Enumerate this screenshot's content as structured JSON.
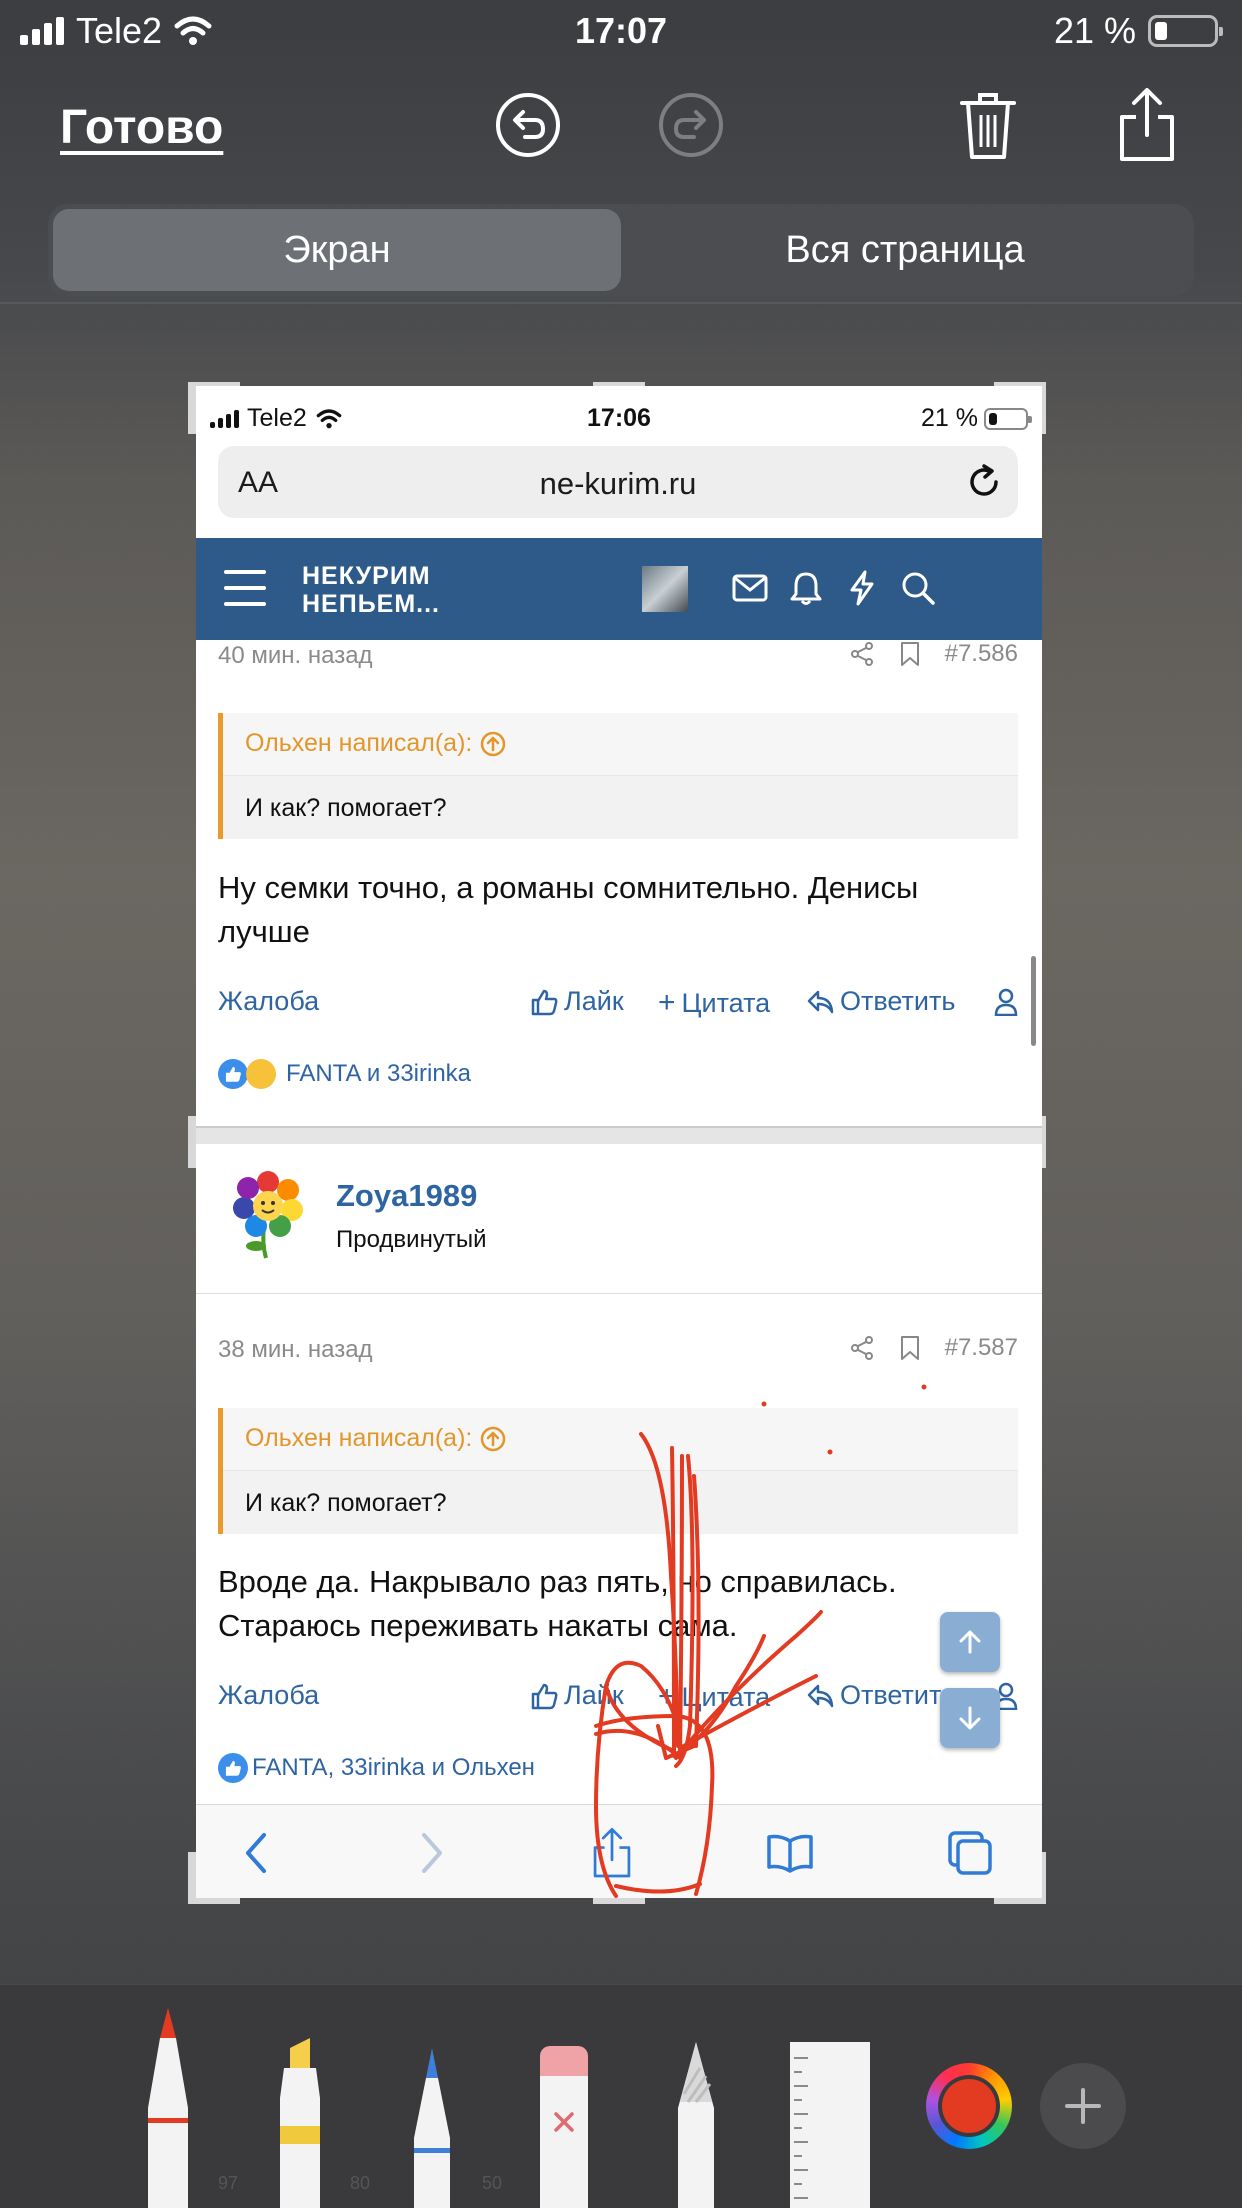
{
  "os_status": {
    "carrier": "Tele2",
    "time": "17:07",
    "battery": "21 %"
  },
  "toolbar": {
    "done_label": "Готово"
  },
  "segments": {
    "screen": "Экран",
    "full_page": "Вся страница"
  },
  "preview": {
    "status": {
      "carrier": "Tele2",
      "time": "17:06",
      "battery": "21 %"
    },
    "url_bar": {
      "aa": "AA",
      "url": "ne-kurim.ru"
    },
    "site": {
      "logo_line1": "НЕКУРИМ",
      "logo_line2": "НЕПЬЕМ..."
    },
    "post1": {
      "time": "40 мин. назад",
      "post_number": "#7.586",
      "quote_author": "Ольхен написал(а):",
      "quote_text": "И как? помогает?",
      "message": "Ну семки точно, а романы сомнительно. Денисы лучше",
      "reactions": "FANTA и 33irinka"
    },
    "post2": {
      "author": "Zoya1989",
      "rank": "Продвинутый",
      "time": "38 мин. назад",
      "post_number": "#7.587",
      "quote_author": "Ольхен написал(а):",
      "quote_text": "И как? помогает?",
      "message": "Вроде да. Накрывало раз пять, но справилась. Стараюсь переживать накаты сама.",
      "reactions": "FANTA, 33irinka и Ольхен"
    },
    "actions": {
      "report": "Жалоба",
      "like": "Лайк",
      "quote": "Цитата",
      "reply": "Ответить"
    }
  },
  "tools": {
    "pen_size": "97",
    "marker_size": "80",
    "pencil_size": "50"
  },
  "colors": {
    "accent_link": "#2f64a3",
    "nav_bg": "#2d5a88",
    "quote_orange": "#e3962a",
    "ink_red": "#e33a22"
  }
}
